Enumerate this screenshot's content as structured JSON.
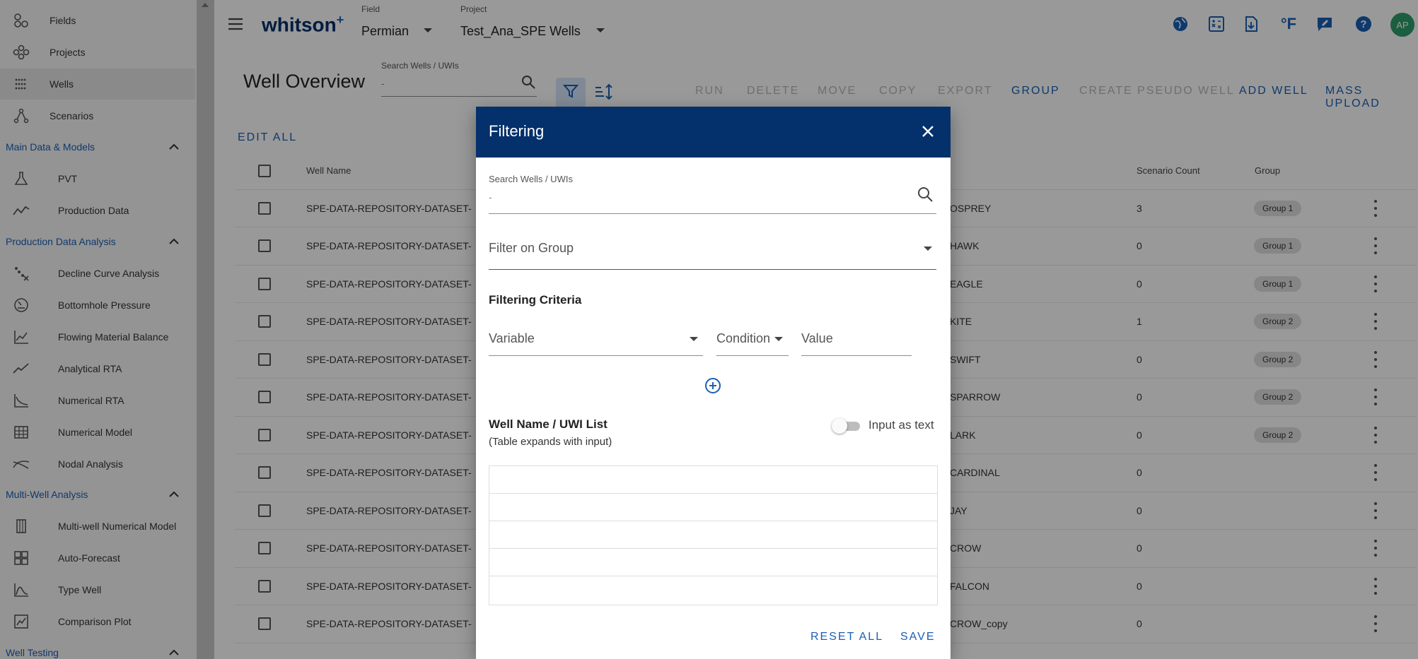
{
  "sidebar": {
    "top_items": [
      {
        "label": "Fields",
        "icon": "fields-icon"
      },
      {
        "label": "Projects",
        "icon": "projects-icon"
      },
      {
        "label": "Wells",
        "icon": "wells-icon",
        "selected": true
      },
      {
        "label": "Scenarios",
        "icon": "scenarios-icon"
      }
    ],
    "sections": [
      {
        "title": "Main Data & Models",
        "items": [
          {
            "label": "PVT",
            "icon": "flask-icon"
          },
          {
            "label": "Production Data",
            "icon": "trend-icon"
          }
        ]
      },
      {
        "title": "Production Data Analysis",
        "items": [
          {
            "label": "Decline Curve Analysis",
            "icon": "decline-icon"
          },
          {
            "label": "Bottomhole Pressure",
            "icon": "gauge-icon"
          },
          {
            "label": "Flowing Material Balance",
            "icon": "chart-icon"
          },
          {
            "label": "Analytical RTA",
            "icon": "line-icon"
          },
          {
            "label": "Numerical RTA",
            "icon": "curve-icon"
          },
          {
            "label": "Numerical Model",
            "icon": "grid-icon"
          },
          {
            "label": "Nodal Analysis",
            "icon": "nodal-icon"
          }
        ]
      },
      {
        "title": "Multi-Well Analysis",
        "items": [
          {
            "label": "Multi-well Numerical Model",
            "icon": "columns-icon"
          },
          {
            "label": "Auto-Forecast",
            "icon": "dashboard-icon"
          },
          {
            "label": "Type Well",
            "icon": "type-curve-icon"
          },
          {
            "label": "Comparison Plot",
            "icon": "comparison-icon"
          }
        ]
      },
      {
        "title": "Well Testing",
        "items": []
      }
    ]
  },
  "header": {
    "brand": "whitson",
    "brand_sup": "+",
    "field_label": "Field",
    "field_value": "Permian",
    "project_label": "Project",
    "project_value": "Test_Ana_SPE Wells",
    "avatar": "AP"
  },
  "main": {
    "title": "Well Overview",
    "search_label": "Search Wells / UWIs",
    "search_value": "-",
    "edit_all": "EDIT ALL",
    "toolbar": {
      "run": "RUN",
      "delete": "DELETE",
      "move": "MOVE",
      "copy": "COPY",
      "export": "EXPORT",
      "group": "GROUP",
      "create_pseudo": "CREATE PSEUDO WELL",
      "add_well": "ADD WELL",
      "mass_upload": "MASS UPLOAD"
    },
    "columns": {
      "well_name": "Well Name",
      "scenario_count": "Scenario Count",
      "group": "Group"
    },
    "rows": [
      {
        "name": "SPE-DATA-REPOSITORY-DATASET-",
        "tail": "OSPREY",
        "count": "3",
        "group": "Group 1"
      },
      {
        "name": "SPE-DATA-REPOSITORY-DATASET-",
        "tail": "HAWK",
        "count": "0",
        "group": "Group 1"
      },
      {
        "name": "SPE-DATA-REPOSITORY-DATASET-",
        "tail": "EAGLE",
        "count": "0",
        "group": "Group 1"
      },
      {
        "name": "SPE-DATA-REPOSITORY-DATASET-",
        "tail": "KITE",
        "count": "1",
        "group": "Group 2"
      },
      {
        "name": "SPE-DATA-REPOSITORY-DATASET-",
        "tail": "SWIFT",
        "count": "0",
        "group": "Group 2"
      },
      {
        "name": "SPE-DATA-REPOSITORY-DATASET-",
        "tail": "SPARROW",
        "count": "0",
        "group": "Group 2"
      },
      {
        "name": "SPE-DATA-REPOSITORY-DATASET-",
        "tail": "LARK",
        "count": "0",
        "group": "Group 2"
      },
      {
        "name": "SPE-DATA-REPOSITORY-DATASET-",
        "tail": "CARDINAL",
        "count": "0",
        "group": ""
      },
      {
        "name": "SPE-DATA-REPOSITORY-DATASET-",
        "tail": "JAY",
        "count": "0",
        "group": ""
      },
      {
        "name": "SPE-DATA-REPOSITORY-DATASET-",
        "tail": "CROW",
        "count": "0",
        "group": ""
      },
      {
        "name": "SPE-DATA-REPOSITORY-DATASET-",
        "tail": "FALCON",
        "count": "0",
        "group": ""
      },
      {
        "name": "SPE-DATA-REPOSITORY-DATASET-",
        "tail": "CROW_copy",
        "count": "0",
        "group": ""
      }
    ]
  },
  "dialog": {
    "title": "Filtering",
    "search_label": "Search Wells / UWIs",
    "search_value": "-",
    "filter_group_placeholder": "Filter on Group",
    "criteria_title": "Filtering Criteria",
    "variable_placeholder": "Variable",
    "condition_placeholder": "Condition",
    "value_placeholder": "Value",
    "list_title": "Well Name / UWI List",
    "list_subtitle": "(Table expands with input)",
    "toggle_label": "Input as text",
    "reset_all": "RESET ALL",
    "save": "SAVE"
  },
  "colors": {
    "accent": "#1a5fb4",
    "dialog_header": "#04306b",
    "overlay": "rgba(0,0,0,0.40)"
  }
}
